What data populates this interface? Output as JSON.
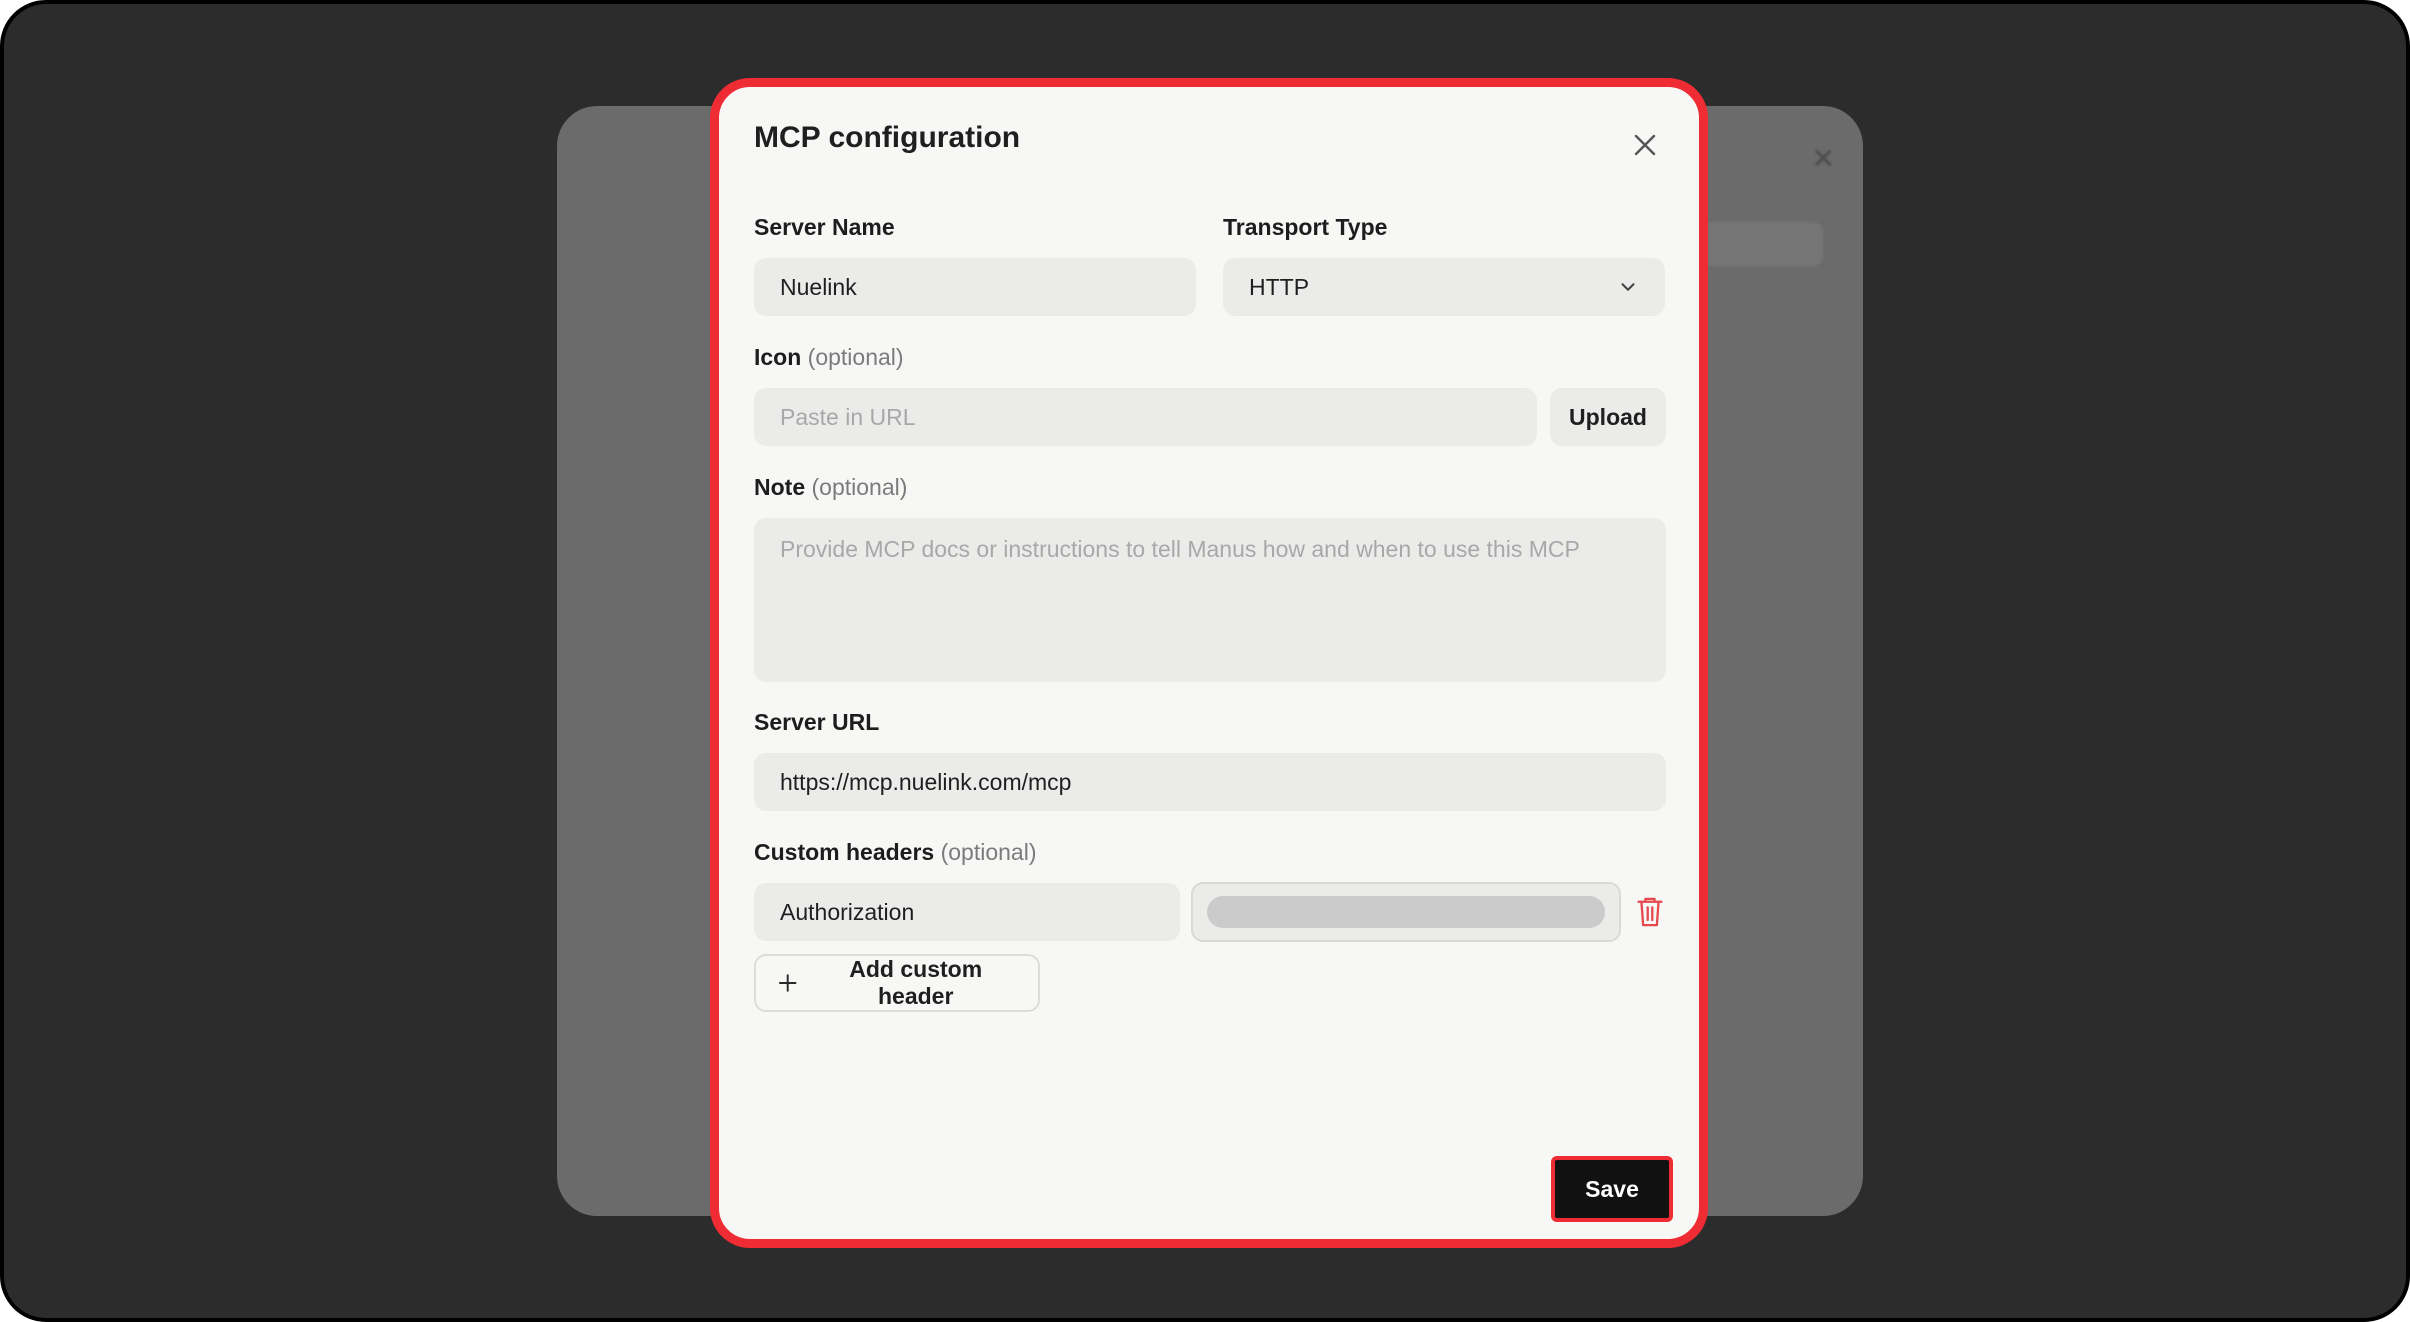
{
  "modal": {
    "title": "MCP configuration",
    "server_name": {
      "label": "Server Name",
      "value": "Nuelink"
    },
    "transport_type": {
      "label": "Transport Type",
      "value": "HTTP"
    },
    "icon": {
      "label": "Icon",
      "optional": "(optional)",
      "placeholder": "Paste in URL",
      "upload_label": "Upload"
    },
    "note": {
      "label": "Note",
      "optional": "(optional)",
      "placeholder": "Provide MCP docs or instructions to tell Manus how and when to use this MCP"
    },
    "server_url": {
      "label": "Server URL",
      "value": "https://mcp.nuelink.com/mcp"
    },
    "custom_headers": {
      "label": "Custom headers",
      "optional": "(optional)",
      "rows": [
        {
          "key": "Authorization"
        }
      ],
      "add_label": "Add custom header"
    },
    "save_label": "Save"
  },
  "colors": {
    "highlight": "#ef2b33",
    "delete": "#e5484d",
    "primary_button": "#111111"
  },
  "icons": {
    "close": "close-icon",
    "chevron": "chevron-down-icon",
    "delete": "trash-icon",
    "add": "plus-icon"
  }
}
